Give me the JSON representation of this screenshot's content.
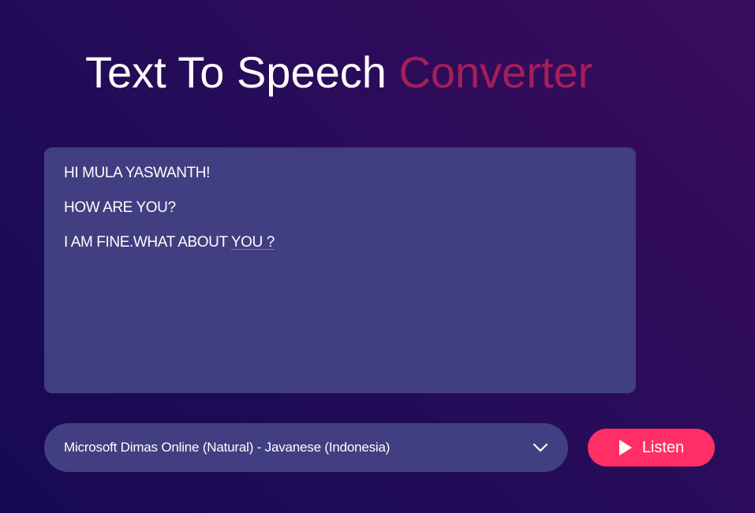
{
  "header": {
    "title_main": "Text To Speech",
    "title_accent": "Converter"
  },
  "editor": {
    "lines": [
      "HI MULA YASWANTH!",
      "HOW ARE YOU?",
      "I AM FINE.WHAT ABOUT "
    ],
    "misspelled_fragment": "YOU ?"
  },
  "voice_select": {
    "selected": "Microsoft Dimas Online (Natural) - Javanese (Indonesia)",
    "icon": "chevron-down-icon"
  },
  "listen_button": {
    "label": "Listen",
    "icon": "play-icon"
  },
  "colors": {
    "title_accent": "#a51e5a",
    "panel": "#413e81",
    "button": "#ff2f65",
    "bg_dark": "#170a52",
    "bg_light": "#3a0d5c"
  }
}
